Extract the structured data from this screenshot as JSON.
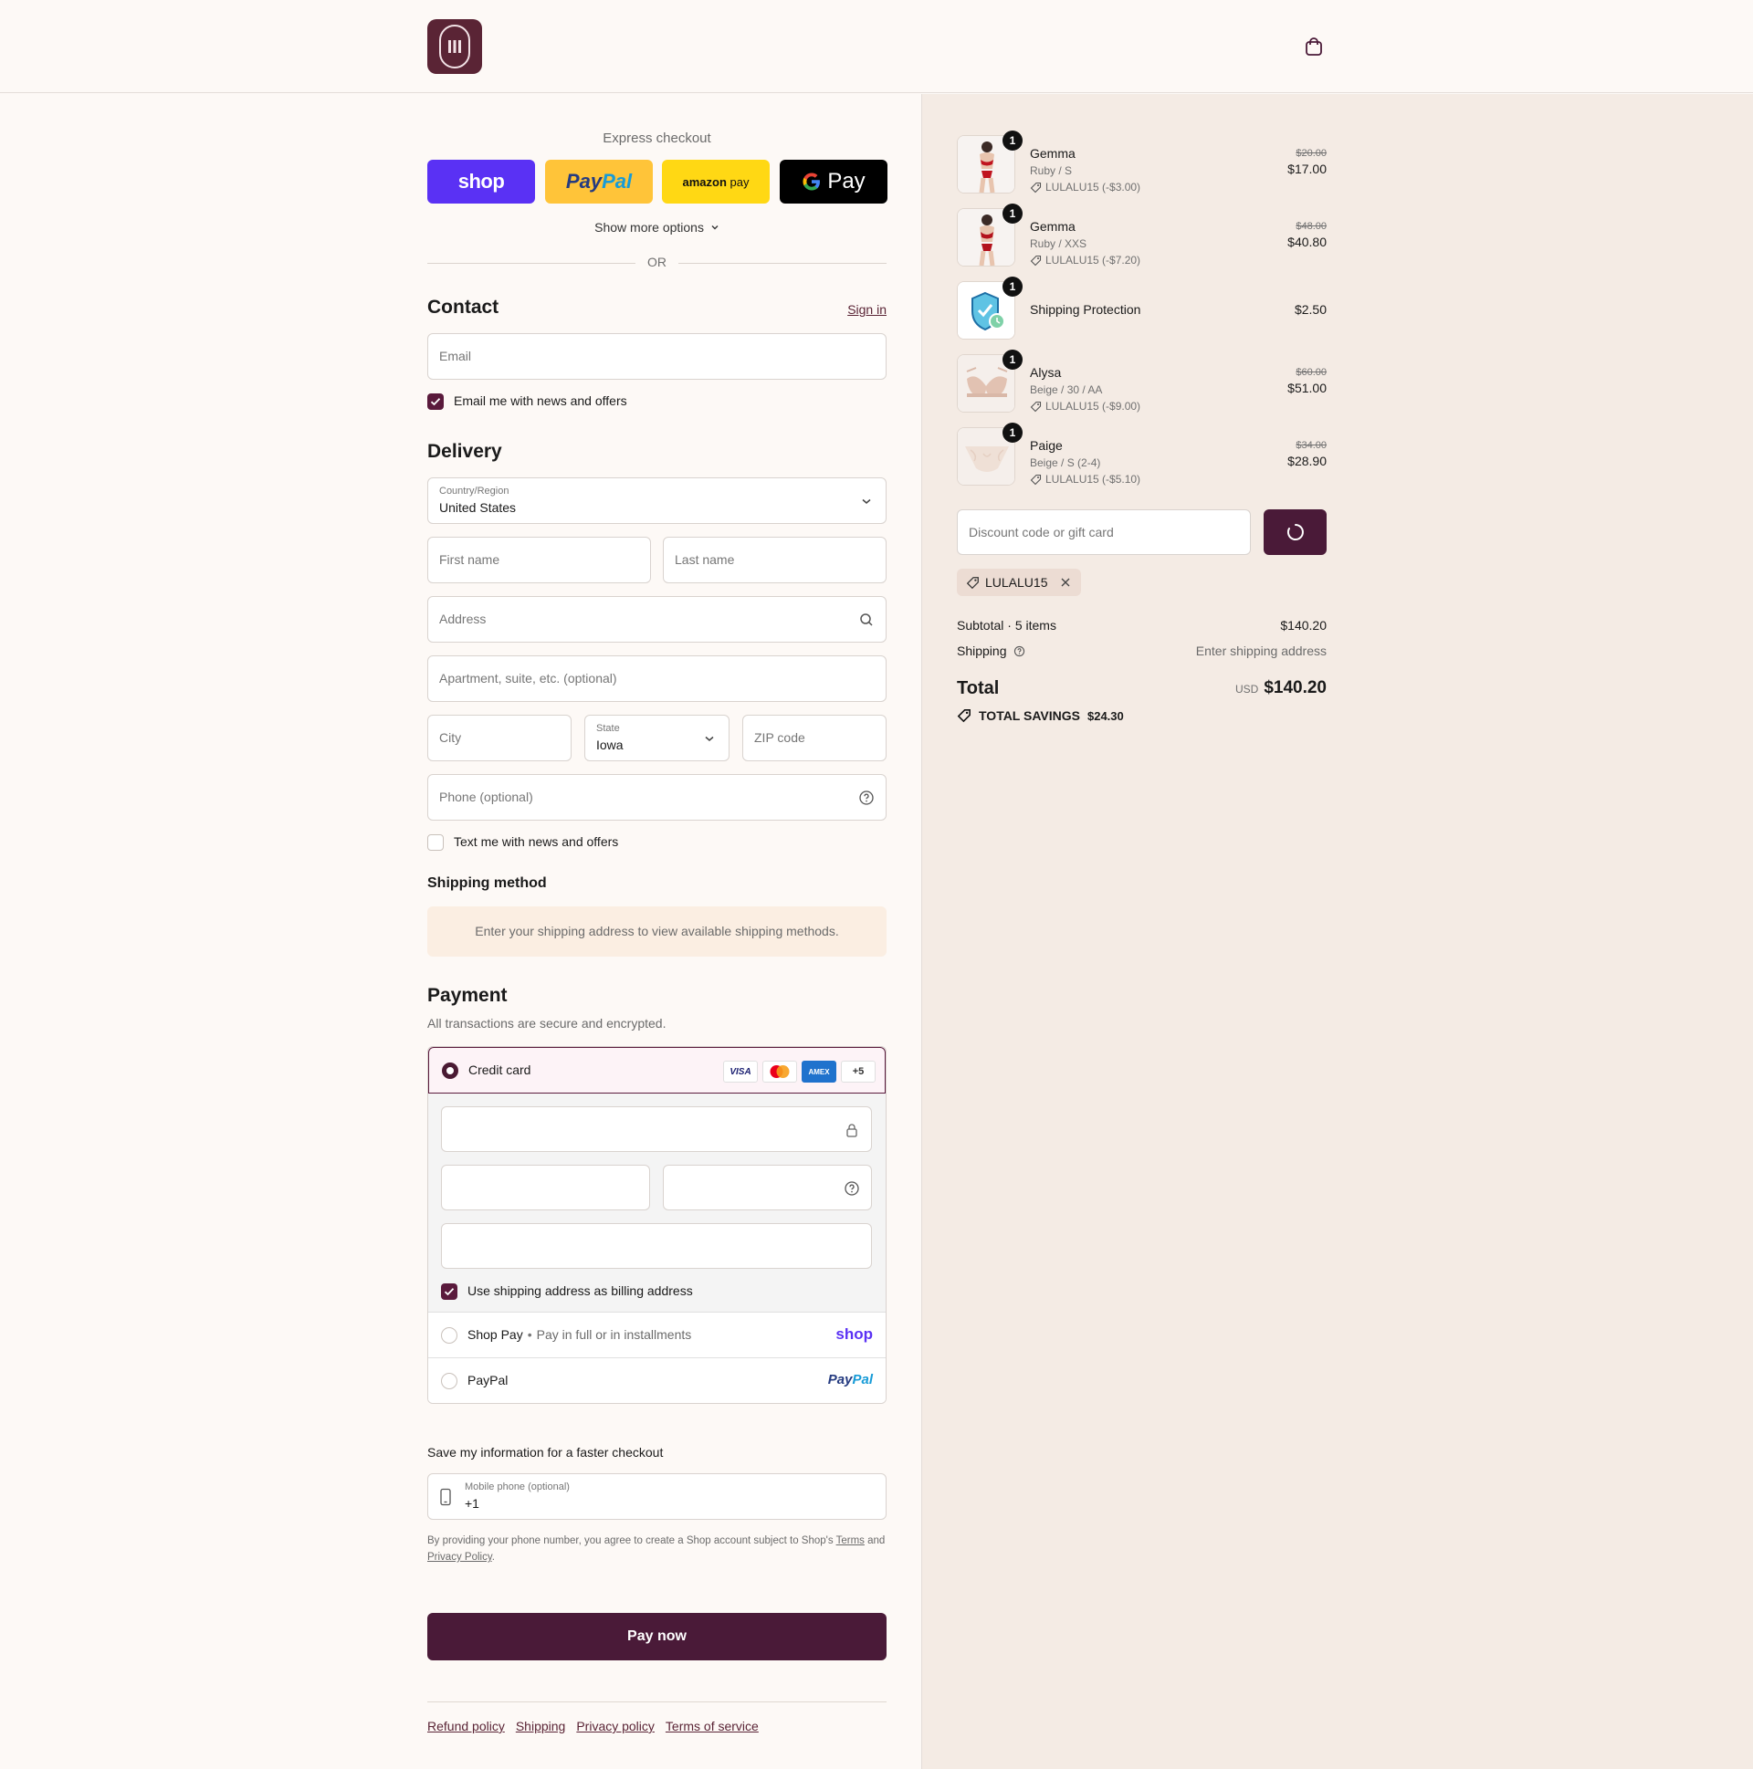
{
  "header": {
    "logo_icon": "brand-logo",
    "cart_icon": "shopping-bag-icon"
  },
  "express": {
    "label": "Express checkout",
    "shop_label": "shop",
    "paypal_a": "Pay",
    "paypal_b": "Pal",
    "amazon_label": "amazon",
    "amazon_pay": "pay",
    "gpay_label": "Pay",
    "show_more": "Show more options",
    "or": "OR"
  },
  "contact": {
    "title": "Contact",
    "sign_in": "Sign in",
    "email_placeholder": "Email",
    "email_news": "Email me with news and offers",
    "email_news_checked": true
  },
  "delivery": {
    "title": "Delivery",
    "country_label": "Country/Region",
    "country_value": "United States",
    "first_name_placeholder": "First name",
    "last_name_placeholder": "Last name",
    "address_placeholder": "Address",
    "apartment_placeholder": "Apartment, suite, etc. (optional)",
    "city_placeholder": "City",
    "state_label": "State",
    "state_value": "Iowa",
    "zip_placeholder": "ZIP code",
    "phone_placeholder": "Phone (optional)",
    "text_news": "Text me with news and offers",
    "text_news_checked": false
  },
  "shipping_method": {
    "title": "Shipping method",
    "notice": "Enter your shipping address to view available shipping methods."
  },
  "payment": {
    "title": "Payment",
    "subtitle": "All transactions are secure and encrypted.",
    "credit_card": "Credit card",
    "card_brands": [
      "VISA",
      "Mastercard",
      "AMEX"
    ],
    "more_cards": "+5",
    "billing_same": "Use shipping address as billing address",
    "shop_pay": "Shop Pay",
    "shop_pay_sub": "Pay in full or in installments",
    "shop_pay_logo": "shop",
    "paypal": "PayPal",
    "paypal_logo_a": "Pay",
    "paypal_logo_b": "Pal"
  },
  "save_info": {
    "title": "Save my information for a faster checkout",
    "mobile_label": "Mobile phone (optional)",
    "mobile_value": "+1",
    "terms_a": "By providing your phone number, you agree to create a Shop account subject to Shop's ",
    "terms_link1": "Terms",
    "terms_b": " and ",
    "terms_link2": "Privacy Policy",
    "terms_c": "."
  },
  "pay_now": "Pay now",
  "footer": [
    "Refund policy",
    "Shipping",
    "Privacy policy",
    "Terms of service"
  ],
  "cart": {
    "items": [
      {
        "qty": "1",
        "name": "Gemma",
        "variant": "Ruby / S",
        "discount": "LULALU15 (-$3.00)",
        "old_price": "$20.00",
        "price": "$17.00"
      },
      {
        "qty": "1",
        "name": "Gemma",
        "variant": "Ruby / XXS",
        "discount": "LULALU15 (-$7.20)",
        "old_price": "$48.00",
        "price": "$40.80"
      },
      {
        "qty": "1",
        "name": "Shipping Protection",
        "variant": "",
        "discount": "",
        "old_price": "",
        "price": "$2.50"
      },
      {
        "qty": "1",
        "name": "Alysa",
        "variant": "Beige / 30 / AA",
        "discount": "LULALU15 (-$9.00)",
        "old_price": "$60.00",
        "price": "$51.00"
      },
      {
        "qty": "1",
        "name": "Paige",
        "variant": "Beige / S (2-4)",
        "discount": "LULALU15 (-$5.10)",
        "old_price": "$34.00",
        "price": "$28.90"
      }
    ],
    "discount_placeholder": "Discount code or gift card",
    "applied_code": "LULALU15",
    "subtotal_label": "Subtotal · 5 items",
    "subtotal_value": "$140.20",
    "shipping_label": "Shipping",
    "shipping_value": "Enter shipping address",
    "total_label": "Total",
    "total_currency": "USD",
    "total_value": "$140.20",
    "savings_label": "TOTAL SAVINGS",
    "savings_value": "$24.30"
  },
  "colors": {
    "accent": "#4a1a38",
    "brand": "#5a2435",
    "shop_purple": "#5a31f4",
    "paypal_yellow": "#ffc439",
    "amazon_yellow": "#ffd814"
  }
}
